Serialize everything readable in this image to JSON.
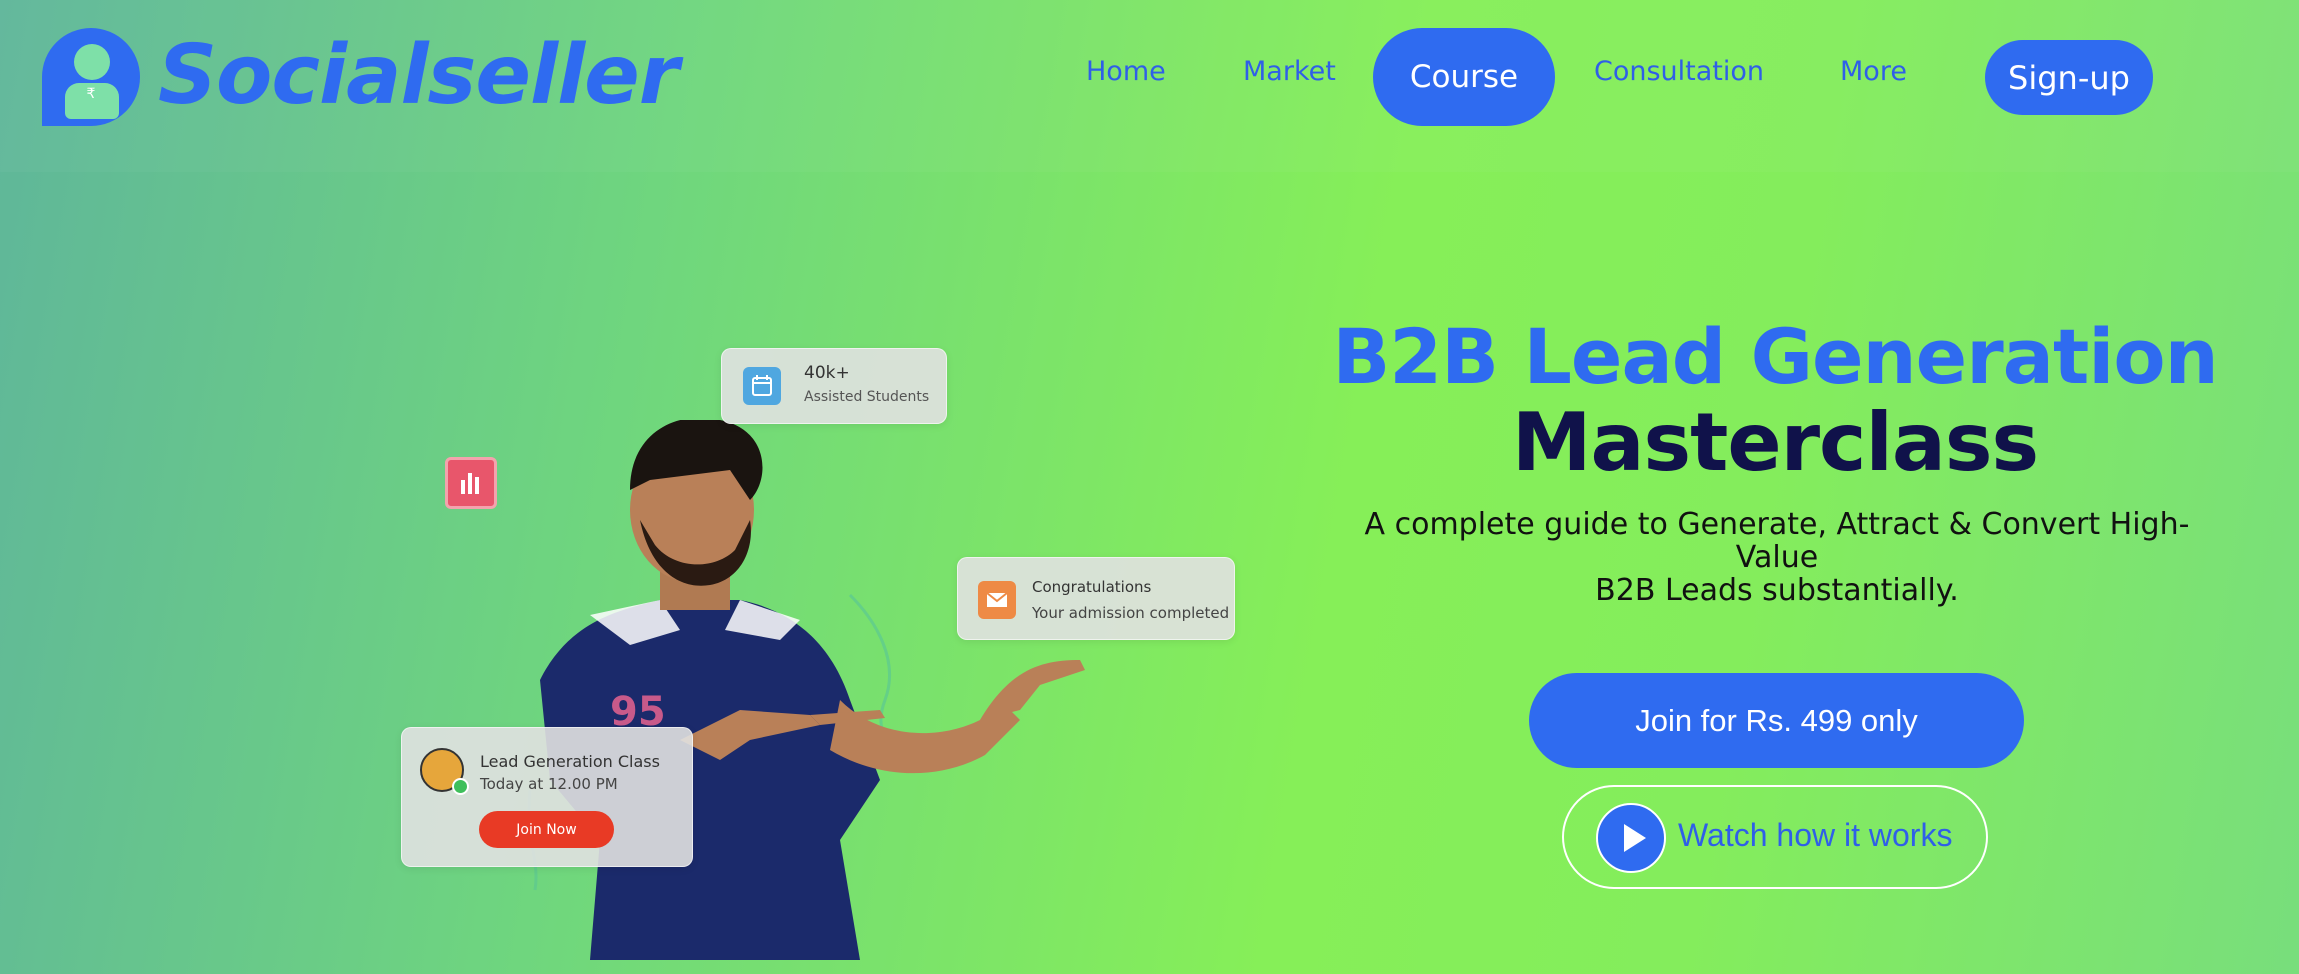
{
  "header": {
    "brand": "Socialseller",
    "logo_symbol": "₹",
    "nav": [
      "Home",
      "Market",
      "Course",
      "Consultation",
      "More"
    ],
    "active_nav": "Course",
    "signup_label": "Sign-up"
  },
  "hero": {
    "title_line1": "B2B Lead Generation",
    "title_line2": "Masterclass",
    "subtitle_line1": "A complete guide to Generate, Attract & Convert High-Value",
    "subtitle_line2": "B2B Leads substantially.",
    "cta_label": "Join for Rs. 499 only",
    "watch_label": "Watch how it works"
  },
  "cards": {
    "students_count": "40k+",
    "students_label": "Assisted Students",
    "congrats_title": "Congratulations",
    "congrats_text": "Your admission completed",
    "class_title": "Lead Generation Class",
    "class_time": "Today at 12.00 PM",
    "class_join": "Join Now"
  },
  "colors": {
    "primary": "#2f6bf0",
    "heading_dark": "#10124a",
    "join_red": "#e83a25"
  },
  "icons": {
    "logo": "user-avatar-icon",
    "students": "calendar-icon",
    "congrats": "mail-icon",
    "badge": "bar-chart-icon",
    "play": "play-icon"
  }
}
